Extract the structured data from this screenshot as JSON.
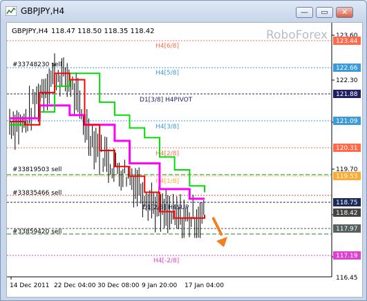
{
  "window": {
    "title": "GBPJPY,H4",
    "minimize_glyph": "—",
    "maximize_glyph": "▭",
    "close_glyph": "✕"
  },
  "chart_header": {
    "symbol": "GBPJPY,H4",
    "ohlc": "118.47 118.50 118.35 118.42",
    "watermark": "RoboForex"
  },
  "price_axis": {
    "ticks": [
      "123.60",
      "122.30",
      "121.09",
      "119.70",
      "118.40",
      "117.19",
      "116.45"
    ],
    "markers": [
      {
        "label": "123.44",
        "color": "#ff6b4a"
      },
      {
        "label": "122.66",
        "color": "#3d9ad8"
      },
      {
        "label": "121.88",
        "color": "#202060"
      },
      {
        "label": "121.09",
        "color": "#3d9ad8"
      },
      {
        "label": "120.31",
        "color": "#ff6b4a"
      },
      {
        "label": "119.53",
        "color": "#ffaa33"
      },
      {
        "label": "118.75",
        "color": "#1a2a5a"
      },
      {
        "label": "118.42",
        "color": "#444444"
      },
      {
        "label": "117.97",
        "color": "#556060"
      },
      {
        "label": "117.19",
        "color": "#e040d0"
      }
    ]
  },
  "time_axis": {
    "ticks": [
      "14 Dec 2011",
      "22 Dec 04:00",
      "30 Dec 08:00",
      "9 Jan 20:00",
      "17 Jan 04:00"
    ]
  },
  "level_labels": [
    {
      "text": "H4[6/8]",
      "color": "#ff6b4a"
    },
    {
      "text": "H4[5/8]",
      "color": "#3d9ad8"
    },
    {
      "text": "D1[3/8] H4PIVOT",
      "color": "#202060"
    },
    {
      "text": "H4[3/8]",
      "color": "#3d9ad8"
    },
    {
      "text": "H4[2/8]",
      "color": "#ff6b4a"
    },
    {
      "text": "H4[1/8]",
      "color": "#ffaa33"
    },
    {
      "text": "D1[2/8] H4SUP",
      "color": "#202060"
    },
    {
      "text": "H4[-2/8]",
      "color": "#e040d0"
    }
  ],
  "orders": [
    {
      "text": "#33748230 sell"
    },
    {
      "text": "#33819503 sell"
    },
    {
      "text": "#33835466 sell"
    },
    {
      "text": "#33859420 sell"
    }
  ],
  "chart_data": {
    "type": "line",
    "title": "GBPJPY,H4",
    "x": [
      "14 Dec 2011",
      "22 Dec 04:00",
      "30 Dec 08:00",
      "9 Jan 20:00",
      "17 Jan 04:00"
    ],
    "ylim": [
      116.3,
      123.9
    ],
    "series": [
      {
        "name": "",
        "color": "#ff00ff",
        "values": [
          121.1,
          121.1,
          121.5,
          121.5,
          121.2,
          120.9,
          120.9,
          120.4,
          119.7,
          119.7,
          118.9,
          118.9,
          118.6,
          118.6
        ]
      },
      {
        "name": "",
        "color": "#00dd00",
        "values": [
          120.9,
          120.9,
          121.3,
          122.1,
          122.5,
          122.5,
          121.6,
          121.2,
          120.8,
          120.5,
          119.9,
          119.5,
          119.0,
          118.8
        ]
      },
      {
        "name": "",
        "color": "#ff0000",
        "values": [
          121.0,
          120.9,
          121.9,
          122.5,
          122.3,
          120.9,
          120.1,
          119.6,
          119.3,
          118.8,
          118.2,
          118.0,
          118.0,
          118.1
        ]
      }
    ],
    "grid": false
  }
}
